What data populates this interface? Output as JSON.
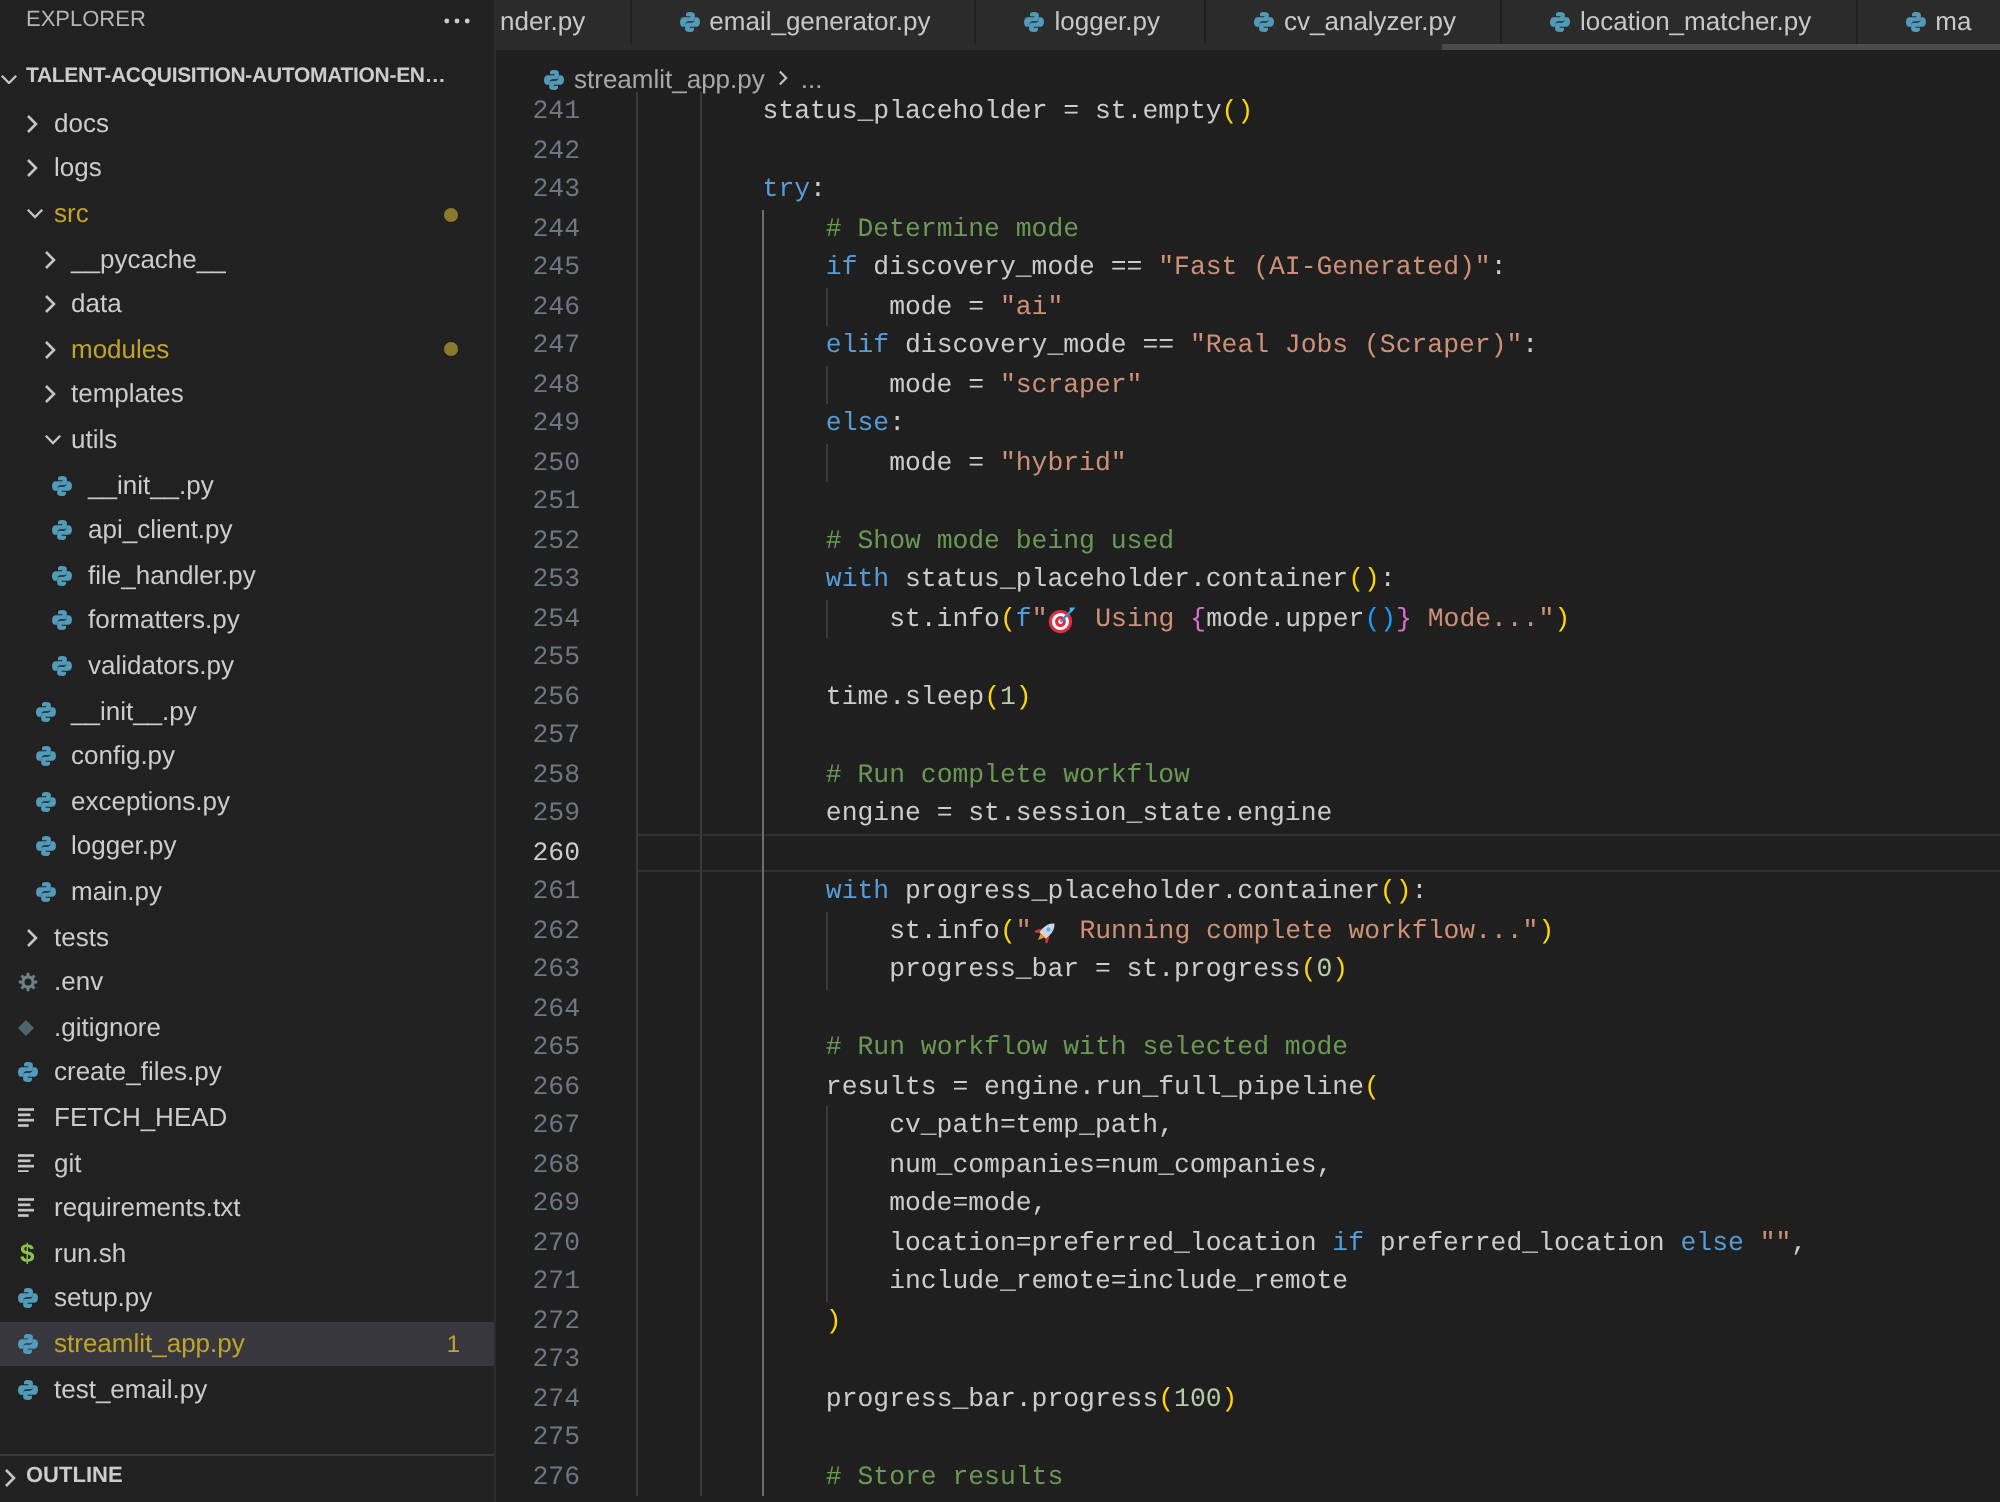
{
  "explorer": {
    "title": "EXPLORER",
    "root": {
      "name": "TALENT-ACQUISITION-AUTOMATION-EN…",
      "expanded": true,
      "children": [
        {
          "name": "docs",
          "kind": "folder",
          "expanded": false,
          "selected": false,
          "warn": false
        },
        {
          "name": "logs",
          "kind": "folder",
          "expanded": false,
          "selected": false,
          "warn": false
        },
        {
          "name": "src",
          "kind": "folder",
          "expanded": true,
          "selected": false,
          "warn": true,
          "children": [
            {
              "name": "__pycache__",
              "kind": "folder",
              "expanded": false,
              "selected": false,
              "warn": false
            },
            {
              "name": "data",
              "kind": "folder",
              "expanded": false,
              "selected": false,
              "warn": false
            },
            {
              "name": "modules",
              "kind": "folder",
              "expanded": false,
              "selected": false,
              "warn": true
            },
            {
              "name": "templates",
              "kind": "folder",
              "expanded": false,
              "selected": false,
              "warn": false
            },
            {
              "name": "utils",
              "kind": "folder",
              "expanded": true,
              "selected": false,
              "warn": false,
              "children": [
                {
                  "name": "__init__.py",
                  "kind": "python",
                  "selected": false,
                  "warn": false
                },
                {
                  "name": "api_client.py",
                  "kind": "python",
                  "selected": false,
                  "warn": false
                },
                {
                  "name": "file_handler.py",
                  "kind": "python",
                  "selected": false,
                  "warn": false
                },
                {
                  "name": "formatters.py",
                  "kind": "python",
                  "selected": false,
                  "warn": false
                },
                {
                  "name": "validators.py",
                  "kind": "python",
                  "selected": false,
                  "warn": false
                }
              ]
            },
            {
              "name": "__init__.py",
              "kind": "python",
              "selected": false,
              "warn": false
            },
            {
              "name": "config.py",
              "kind": "python",
              "selected": false,
              "warn": false
            },
            {
              "name": "exceptions.py",
              "kind": "python",
              "selected": false,
              "warn": false
            },
            {
              "name": "logger.py",
              "kind": "python",
              "selected": false,
              "warn": false
            },
            {
              "name": "main.py",
              "kind": "python",
              "selected": false,
              "warn": false
            }
          ]
        },
        {
          "name": "tests",
          "kind": "folder",
          "expanded": false,
          "selected": false,
          "warn": false
        },
        {
          "name": ".env",
          "kind": "env",
          "selected": false,
          "warn": false
        },
        {
          "name": ".gitignore",
          "kind": "gitignore",
          "selected": false,
          "warn": false
        },
        {
          "name": "create_files.py",
          "kind": "python",
          "selected": false,
          "warn": false
        },
        {
          "name": "FETCH_HEAD",
          "kind": "text",
          "selected": false,
          "warn": false
        },
        {
          "name": "git",
          "kind": "text",
          "selected": false,
          "warn": false
        },
        {
          "name": "requirements.txt",
          "kind": "text",
          "selected": false,
          "warn": false
        },
        {
          "name": "run.sh",
          "kind": "shell",
          "glyph": "$",
          "selected": false,
          "warn": false
        },
        {
          "name": "setup.py",
          "kind": "python",
          "selected": false,
          "warn": false
        },
        {
          "name": "streamlit_app.py",
          "kind": "python",
          "selected": true,
          "warn": true,
          "count": "1"
        },
        {
          "name": "test_email.py",
          "kind": "python",
          "selected": false,
          "warn": false
        }
      ]
    },
    "outline": {
      "title": "OUTLINE",
      "expanded": false
    }
  },
  "tabs": [
    {
      "label": "nder.py",
      "kind": "plain",
      "selected": false
    },
    {
      "label": "email_generator.py",
      "kind": "python",
      "selected": false
    },
    {
      "label": "logger.py",
      "kind": "python",
      "selected": false
    },
    {
      "label": "cv_analyzer.py",
      "kind": "python",
      "selected": false
    },
    {
      "label": "location_matcher.py",
      "kind": "python",
      "selected": false
    },
    {
      "label": "ma",
      "kind": "python",
      "selected": false
    }
  ],
  "breadcrumb": [
    {
      "label": "streamlit_app.py",
      "kind": "python"
    },
    {
      "label": "...",
      "kind": "plain"
    }
  ],
  "editor": {
    "lines": [
      {
        "number": "241",
        "current": false,
        "tokens": [
          {
            "text": "status_placeholder = st.empty",
            "kind": "plain"
          },
          {
            "text": "()",
            "kind": "bracket1"
          }
        ]
      },
      {
        "number": "242",
        "current": false
      },
      {
        "number": "243",
        "current": false,
        "tokens": [
          {
            "text": "try",
            "kind": "keyword"
          },
          {
            "text": ":",
            "kind": "plain"
          }
        ],
        "children": [
          {
            "number": "244",
            "current": false,
            "tokens": [
              {
                "text": "# Determine mode",
                "kind": "comment"
              }
            ]
          },
          {
            "number": "245",
            "current": false,
            "tokens": [
              {
                "text": "if",
                "kind": "keyword"
              },
              {
                "text": " discovery_mode == ",
                "kind": "plain"
              },
              {
                "text": "\"Fast (AI-Generated)\"",
                "kind": "string"
              },
              {
                "text": ":",
                "kind": "plain"
              }
            ],
            "children": [
              {
                "number": "246",
                "current": false,
                "tokens": [
                  {
                    "text": "mode = ",
                    "kind": "plain"
                  },
                  {
                    "text": "\"ai\"",
                    "kind": "string"
                  }
                ]
              }
            ]
          },
          {
            "number": "247",
            "current": false,
            "tokens": [
              {
                "text": "elif",
                "kind": "keyword"
              },
              {
                "text": " discovery_mode == ",
                "kind": "plain"
              },
              {
                "text": "\"Real Jobs (Scraper)\"",
                "kind": "string"
              },
              {
                "text": ":",
                "kind": "plain"
              }
            ],
            "children": [
              {
                "number": "248",
                "current": false,
                "tokens": [
                  {
                    "text": "mode = ",
                    "kind": "plain"
                  },
                  {
                    "text": "\"scraper\"",
                    "kind": "string"
                  }
                ]
              }
            ]
          },
          {
            "number": "249",
            "current": false,
            "tokens": [
              {
                "text": "else",
                "kind": "keyword"
              },
              {
                "text": ":",
                "kind": "plain"
              }
            ],
            "children": [
              {
                "number": "250",
                "current": false,
                "tokens": [
                  {
                    "text": "mode = ",
                    "kind": "plain"
                  },
                  {
                    "text": "\"hybrid\"",
                    "kind": "string"
                  }
                ]
              }
            ]
          },
          {
            "number": "251",
            "current": false
          },
          {
            "number": "252",
            "current": false,
            "tokens": [
              {
                "text": "# Show mode being used",
                "kind": "comment"
              }
            ]
          },
          {
            "number": "253",
            "current": false,
            "tokens": [
              {
                "text": "with",
                "kind": "keyword"
              },
              {
                "text": " status_placeholder.container",
                "kind": "plain"
              },
              {
                "text": "()",
                "kind": "bracket1"
              },
              {
                "text": ":",
                "kind": "plain"
              }
            ],
            "children": [
              {
                "number": "254",
                "current": false,
                "tokens": [
                  {
                    "text": "st.info",
                    "kind": "plain"
                  },
                  {
                    "text": "(",
                    "kind": "bracket1"
                  },
                  {
                    "text": "f",
                    "kind": "prefix"
                  },
                  {
                    "text": "\"",
                    "kind": "string"
                  },
                  {
                    "kind": "dartboard"
                  },
                  {
                    "text": " Using ",
                    "kind": "string"
                  },
                  {
                    "text": "{",
                    "kind": "bracket2"
                  },
                  {
                    "text": "mode.upper",
                    "kind": "plain"
                  },
                  {
                    "text": "()",
                    "kind": "bracket3"
                  },
                  {
                    "text": "}",
                    "kind": "bracket2"
                  },
                  {
                    "text": " Mode...\"",
                    "kind": "string"
                  },
                  {
                    "text": ")",
                    "kind": "bracket1"
                  }
                ]
              }
            ]
          },
          {
            "number": "255",
            "current": false
          },
          {
            "number": "256",
            "current": false,
            "tokens": [
              {
                "text": "time.sleep",
                "kind": "plain"
              },
              {
                "text": "(",
                "kind": "bracket1"
              },
              {
                "text": "1",
                "kind": "number"
              },
              {
                "text": ")",
                "kind": "bracket1"
              }
            ]
          },
          {
            "number": "257",
            "current": false
          },
          {
            "number": "258",
            "current": false,
            "tokens": [
              {
                "text": "# Run complete workflow",
                "kind": "comment"
              }
            ]
          },
          {
            "number": "259",
            "current": false,
            "tokens": [
              {
                "text": "engine = st.session_state.engine",
                "kind": "plain"
              }
            ]
          },
          {
            "number": "260",
            "current": true
          },
          {
            "number": "261",
            "current": false,
            "tokens": [
              {
                "text": "with",
                "kind": "keyword"
              },
              {
                "text": " progress_placeholder.container",
                "kind": "plain"
              },
              {
                "text": "()",
                "kind": "bracket1"
              },
              {
                "text": ":",
                "kind": "plain"
              }
            ],
            "children": [
              {
                "number": "262",
                "current": false,
                "tokens": [
                  {
                    "text": "st.info",
                    "kind": "plain"
                  },
                  {
                    "text": "(",
                    "kind": "bracket1"
                  },
                  {
                    "text": "\"",
                    "kind": "string"
                  },
                  {
                    "kind": "rocket"
                  },
                  {
                    "text": " Running complete workflow...\"",
                    "kind": "string"
                  },
                  {
                    "text": ")",
                    "kind": "bracket1"
                  }
                ]
              },
              {
                "number": "263",
                "current": false,
                "tokens": [
                  {
                    "text": "progress_bar = st.progress",
                    "kind": "plain"
                  },
                  {
                    "text": "(",
                    "kind": "bracket1"
                  },
                  {
                    "text": "0",
                    "kind": "number"
                  },
                  {
                    "text": ")",
                    "kind": "bracket1"
                  }
                ]
              }
            ]
          },
          {
            "number": "264",
            "current": false
          },
          {
            "number": "265",
            "current": false,
            "tokens": [
              {
                "text": "# Run workflow with selected mode",
                "kind": "comment"
              }
            ]
          },
          {
            "number": "266",
            "current": false,
            "tokens": [
              {
                "text": "results = engine.run_full_pipeline",
                "kind": "plain"
              },
              {
                "text": "(",
                "kind": "bracket1"
              }
            ],
            "children": [
              {
                "number": "267",
                "current": false,
                "tokens": [
                  {
                    "text": "cv_path=temp_path,",
                    "kind": "plain"
                  }
                ]
              },
              {
                "number": "268",
                "current": false,
                "tokens": [
                  {
                    "text": "num_companies=num_companies,",
                    "kind": "plain"
                  }
                ]
              },
              {
                "number": "269",
                "current": false,
                "tokens": [
                  {
                    "text": "mode=mode,",
                    "kind": "plain"
                  }
                ]
              },
              {
                "number": "270",
                "current": false,
                "tokens": [
                  {
                    "text": "location=preferred_location ",
                    "kind": "plain"
                  },
                  {
                    "text": "if",
                    "kind": "keyword"
                  },
                  {
                    "text": " preferred_location ",
                    "kind": "plain"
                  },
                  {
                    "text": "else",
                    "kind": "keyword"
                  },
                  {
                    "text": " \"\"",
                    "kind": "string"
                  },
                  {
                    "text": ",",
                    "kind": "plain"
                  }
                ]
              },
              {
                "number": "271",
                "current": false,
                "tokens": [
                  {
                    "text": "include_remote=include_remote",
                    "kind": "plain"
                  }
                ]
              }
            ]
          },
          {
            "number": "272",
            "current": false,
            "tokens": [
              {
                "text": ")",
                "kind": "bracket1"
              }
            ]
          },
          {
            "number": "273",
            "current": false
          },
          {
            "number": "274",
            "current": false,
            "tokens": [
              {
                "text": "progress_bar.progress",
                "kind": "plain"
              },
              {
                "text": "(",
                "kind": "bracket1"
              },
              {
                "text": "100",
                "kind": "number"
              },
              {
                "text": ")",
                "kind": "bracket1"
              }
            ]
          },
          {
            "number": "275",
            "current": false
          },
          {
            "number": "276",
            "current": false,
            "tokens": [
              {
                "text": "# Store results",
                "kind": "comment"
              }
            ]
          }
        ]
      }
    ]
  }
}
